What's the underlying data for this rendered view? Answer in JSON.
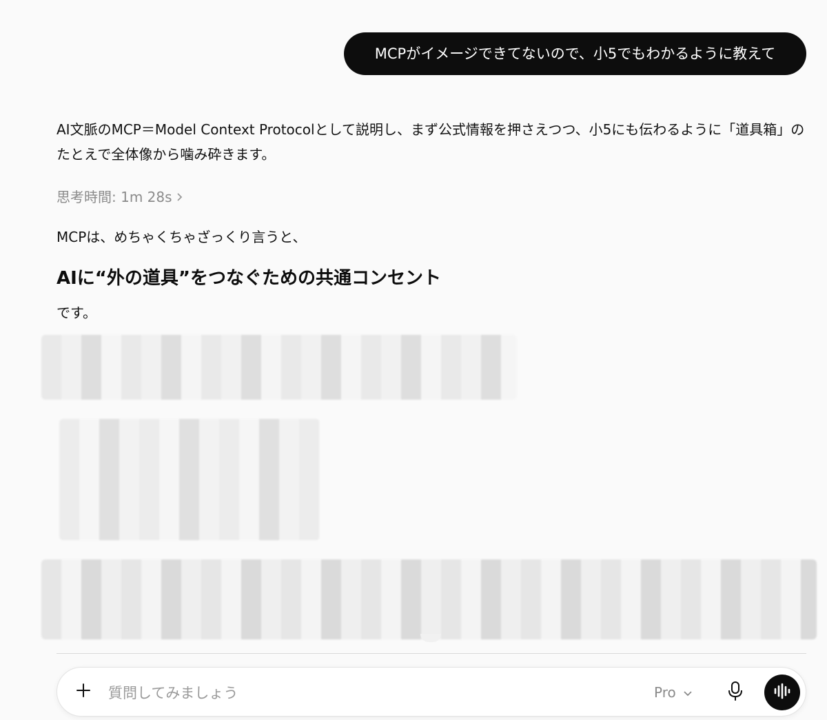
{
  "user_message": "MCPがイメージできてないので、小5でもわかるように教えて",
  "assistant": {
    "intro": "AI文脈のMCP＝Model Context Protocolとして説明し、まず公式情報を押さえつつ、小5にも伝わるように「道具箱」のたとえで全体像から噛み砕きます。",
    "thinking_label": "思考時間: 1m 28s",
    "paragraph_1": "MCPは、めちゃくちゃざっくり言うと、",
    "heading": "AIに“外の道具”をつなぐための共通コンセント",
    "paragraph_2": "です。"
  },
  "composer": {
    "placeholder": "質問してみましょう",
    "model_label": "Pro"
  },
  "icons": {
    "add": "plus-icon",
    "model_dropdown": "chevron-down-icon",
    "mic": "microphone-icon",
    "voice": "voice-waveform-icon",
    "thinking_expand": "chevron-right-icon"
  }
}
